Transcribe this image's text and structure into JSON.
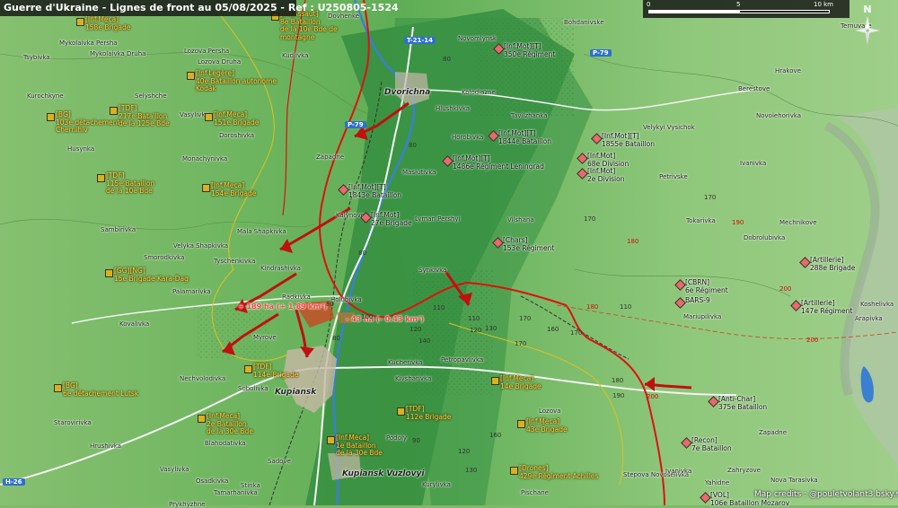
{
  "map": {
    "title": "Guerre d'Ukraine - Lignes de front au 05/08/2025 - Ref : U250805-1524",
    "credits": "Map credits : @pouletvolant3.bsky.social",
    "scale": {
      "labels": [
        "0",
        "5",
        "10 km"
      ]
    },
    "compass_label": "N",
    "colors": {
      "ukraine_label": "#ffd33a",
      "front_line": "#e01010",
      "russian_unit": "#e86a6a",
      "ukraine_unit": "#d9b21a",
      "water": "#3a7fd0"
    }
  },
  "roads": [
    {
      "id": "r1",
      "label": "T-21-14"
    },
    {
      "id": "r2",
      "label": "P-79"
    },
    {
      "id": "r3",
      "label": "P-79"
    },
    {
      "id": "r4",
      "label": "H-26"
    }
  ],
  "areas": [
    {
      "id": "a1",
      "label": "+ 189 ha (+ 1.89 km²)"
    },
    {
      "id": "a2",
      "label": "- 43 ha (- 0.43 km²)"
    }
  ],
  "towns": [
    {
      "id": "t1",
      "label": "Dovhenke",
      "major": false
    },
    {
      "id": "t2",
      "label": "Bohdanivske",
      "major": false
    },
    {
      "id": "t3",
      "label": "Ternuvate",
      "major": false
    },
    {
      "id": "t4",
      "label": "Mykolaivka Persha",
      "major": false
    },
    {
      "id": "t5",
      "label": "Mykolaivka Druha",
      "major": false
    },
    {
      "id": "t6",
      "label": "Tsybivka",
      "major": false
    },
    {
      "id": "t7",
      "label": "Lozova Persha",
      "major": false
    },
    {
      "id": "t8",
      "label": "Lozova Druha",
      "major": false
    },
    {
      "id": "t9",
      "label": "Kudiivka",
      "major": false
    },
    {
      "id": "t10",
      "label": "Novomlynsk",
      "major": false
    },
    {
      "id": "t11",
      "label": "Hrakove",
      "major": false
    },
    {
      "id": "t12",
      "label": "Berestove",
      "major": false
    },
    {
      "id": "t13",
      "label": "Kurochkyne",
      "major": false
    },
    {
      "id": "t14",
      "label": "Selyshche",
      "major": false
    },
    {
      "id": "t15",
      "label": "Dvorichna",
      "major": true
    },
    {
      "id": "t16",
      "label": "Kolodiazne",
      "major": false
    },
    {
      "id": "t17",
      "label": "Hlushkivka",
      "major": false
    },
    {
      "id": "t18",
      "label": "Tavilzhanka",
      "major": false
    },
    {
      "id": "t19",
      "label": "Velykyi Vysichok",
      "major": false
    },
    {
      "id": "t20",
      "label": "Novoiehorivka",
      "major": false
    },
    {
      "id": "t21",
      "label": "Vasylivka",
      "major": false
    },
    {
      "id": "t22",
      "label": "Doroshivka",
      "major": false
    },
    {
      "id": "t23",
      "label": "Horobivka",
      "major": false
    },
    {
      "id": "t24",
      "label": "Husynka",
      "major": false
    },
    {
      "id": "t25",
      "label": "Monachynivka",
      "major": false
    },
    {
      "id": "t26",
      "label": "Zapadne",
      "major": false
    },
    {
      "id": "t27",
      "label": "Masiutivka",
      "major": false
    },
    {
      "id": "t28",
      "label": "Petrivske",
      "major": false
    },
    {
      "id": "t29",
      "label": "Ivanivka",
      "major": false
    },
    {
      "id": "t30",
      "label": "Kalynove",
      "major": false
    },
    {
      "id": "t31",
      "label": "Lyman Pershyi",
      "major": false
    },
    {
      "id": "t32",
      "label": "Vilshana",
      "major": false
    },
    {
      "id": "t33",
      "label": "Tokarivka",
      "major": false
    },
    {
      "id": "t34",
      "label": "Mechnikove",
      "major": false
    },
    {
      "id": "t35",
      "label": "Sambirivka",
      "major": false
    },
    {
      "id": "t36",
      "label": "Mala Shapkivka",
      "major": false
    },
    {
      "id": "t37",
      "label": "Velyka Shapkivka",
      "major": false
    },
    {
      "id": "t38",
      "label": "Dobrolubivka",
      "major": false
    },
    {
      "id": "t39",
      "label": "Smorodkivka",
      "major": false
    },
    {
      "id": "t40",
      "label": "Tyschenkivka",
      "major": false
    },
    {
      "id": "t41",
      "label": "Kindrashivka",
      "major": false
    },
    {
      "id": "t42",
      "label": "Synkivka",
      "major": false
    },
    {
      "id": "t43",
      "label": "Palamarivka",
      "major": false
    },
    {
      "id": "t44",
      "label": "Radkivka",
      "major": false
    },
    {
      "id": "t45",
      "label": "Holubivka",
      "major": false
    },
    {
      "id": "t46",
      "label": "Kovalivka",
      "major": false
    },
    {
      "id": "t47",
      "label": "Myrove",
      "major": false
    },
    {
      "id": "t48",
      "label": "Mariupilivka",
      "major": false
    },
    {
      "id": "t49",
      "label": "Arapivka",
      "major": false
    },
    {
      "id": "t50",
      "label": "Koshelivka",
      "major": false
    },
    {
      "id": "t51",
      "label": "Petropavlivka",
      "major": false
    },
    {
      "id": "t52",
      "label": "Kucherivka",
      "major": false
    },
    {
      "id": "t53",
      "label": "Nechvolodivka",
      "major": false
    },
    {
      "id": "t54",
      "label": "Sobolivka",
      "major": false
    },
    {
      "id": "t55",
      "label": "Kupiansk",
      "major": true
    },
    {
      "id": "t56",
      "label": "Kivsharivka",
      "major": false
    },
    {
      "id": "t57",
      "label": "Lozova",
      "major": false
    },
    {
      "id": "t58",
      "label": "Starovirivka",
      "major": false
    },
    {
      "id": "t59",
      "label": "Hrushivka",
      "major": false
    },
    {
      "id": "t60",
      "label": "Blahodativka",
      "major": false
    },
    {
      "id": "t61",
      "label": "Vasylivka",
      "major": false
    },
    {
      "id": "t62",
      "label": "Sadove",
      "major": false
    },
    {
      "id": "t63",
      "label": "Podoly",
      "major": false
    },
    {
      "id": "t64",
      "label": "Kupiansk Vuzlovyi",
      "major": true
    },
    {
      "id": "t65",
      "label": "Kurylivka",
      "major": false
    },
    {
      "id": "t66",
      "label": "Stepova Novoselivka",
      "major": false
    },
    {
      "id": "t67",
      "label": "Ivanivka",
      "major": false
    },
    {
      "id": "t68",
      "label": "Zahryzove",
      "major": false
    },
    {
      "id": "t69",
      "label": "Zapadne",
      "major": false
    },
    {
      "id": "t70",
      "label": "Nova Tarasivka",
      "major": false
    },
    {
      "id": "t71",
      "label": "Yahidne",
      "major": false
    },
    {
      "id": "t72",
      "label": "Osadkivka",
      "major": false
    },
    {
      "id": "t73",
      "label": "Tamarhanivka",
      "major": false
    },
    {
      "id": "t74",
      "label": "Stinka",
      "major": false
    },
    {
      "id": "t75",
      "label": "Pischane",
      "major": false
    },
    {
      "id": "t76",
      "label": "Prykhyzhne",
      "major": false
    }
  ],
  "units_ukraine": [
    {
      "id": "u1",
      "lines": [
        "[Inf.Meca]",
        "158e Brigade"
      ]
    },
    {
      "id": "u2",
      "lines": [
        "[Inf.Assaut]",
        "8e Bataillon",
        "de la 10e Bde de",
        "montagne"
      ]
    },
    {
      "id": "u3",
      "lines": [
        "[Inf.Légère]",
        "40e Bataillon autonome",
        "Kodak"
      ]
    },
    {
      "id": "u4",
      "lines": [
        "[BG]",
        "103e détachement",
        "Chernihiv"
      ]
    },
    {
      "id": "u5",
      "lines": [
        "[TDF]",
        "217e Bataillon",
        "de la 125e Bde"
      ]
    },
    {
      "id": "u6",
      "lines": [
        "[Inf.Meca]",
        "151e Brigade"
      ]
    },
    {
      "id": "u7",
      "lines": [
        "[TDF]",
        "115e Bataillon",
        "de la 10e Bde"
      ]
    },
    {
      "id": "u8",
      "lines": [
        "[Inf.Meca]",
        "154e Brigade"
      ]
    },
    {
      "id": "u9",
      "lines": [
        "[GG][NG]",
        "15e Brigade Kara-Dag"
      ]
    },
    {
      "id": "u10",
      "lines": [
        "[BG]",
        "6e détachement Lutsk"
      ]
    },
    {
      "id": "u11",
      "lines": [
        "[TDF]",
        "114e Brigade"
      ]
    },
    {
      "id": "u12",
      "lines": [
        "[Inf.Meca]",
        "2e Bataillon",
        "de la 30e Bde"
      ]
    },
    {
      "id": "u13",
      "lines": [
        "[Inf.Meca]",
        "1e Bataillon",
        "de la 30e Bde"
      ]
    },
    {
      "id": "u14",
      "lines": [
        "[TDF]",
        "112e Brigade"
      ]
    },
    {
      "id": "u15",
      "lines": [
        "[Inf.Meca]",
        "14e Brigade"
      ]
    },
    {
      "id": "u16",
      "lines": [
        "[Inf.Meca]",
        "43e Brigade"
      ]
    },
    {
      "id": "u17",
      "lines": [
        "[Drones]",
        "429e Régiment Achilles"
      ]
    }
  ],
  "units_russia": [
    {
      "id": "r1",
      "lines": [
        "[Inf.Mot][T]",
        "350e Régiment"
      ]
    },
    {
      "id": "r2",
      "lines": [
        "[Inf.Mot][T]",
        "1844e Bataillon"
      ]
    },
    {
      "id": "r3",
      "lines": [
        "[Inf.Mot][T]",
        "1855e Bataillon"
      ]
    },
    {
      "id": "r4",
      "lines": [
        "[Inf.Mot][T]",
        "1486e Régiment Leningrad"
      ]
    },
    {
      "id": "r5",
      "lines": [
        "[Inf.Mot]",
        "68e Division"
      ]
    },
    {
      "id": "r6",
      "lines": [
        "[Inf.Mot]",
        "2e Division"
      ]
    },
    {
      "id": "r7",
      "lines": [
        "[Inf.Mot][T]",
        "1843e Bataillon"
      ]
    },
    {
      "id": "r8",
      "lines": [
        "[Inf.Mot]",
        "27e Brigade"
      ]
    },
    {
      "id": "r9",
      "lines": [
        "[Chars]",
        "153e Régiment"
      ]
    },
    {
      "id": "r10",
      "lines": [
        "[Artillerie]",
        "288e Brigade"
      ]
    },
    {
      "id": "r11",
      "lines": [
        "[CBRN]",
        "6e Régiment"
      ]
    },
    {
      "id": "r12",
      "lines": [
        "BARS-9"
      ]
    },
    {
      "id": "r13",
      "lines": [
        "[Artillerie]",
        "147e Régiment"
      ]
    },
    {
      "id": "r14",
      "lines": [
        "[Anti-Char]",
        "375e Bataillon"
      ]
    },
    {
      "id": "r15",
      "lines": [
        "[Recon]",
        "7e Bataillon"
      ]
    },
    {
      "id": "r16",
      "lines": [
        "[VOL]",
        "106e Bataillon Mozarov"
      ]
    }
  ],
  "elevations": [
    {
      "id": "e1",
      "label": "80",
      "red": false
    },
    {
      "id": "e2",
      "label": "80",
      "red": false
    },
    {
      "id": "e3",
      "label": "170",
      "red": false
    },
    {
      "id": "e4",
      "label": "170",
      "red": false
    },
    {
      "id": "e5",
      "label": "190",
      "red": true
    },
    {
      "id": "e6",
      "label": "180",
      "red": true
    },
    {
      "id": "e7",
      "label": "180",
      "red": true
    },
    {
      "id": "e8",
      "label": "110",
      "red": false
    },
    {
      "id": "e9",
      "label": "200",
      "red": true
    },
    {
      "id": "e10",
      "label": "200",
      "red": true
    },
    {
      "id": "e11",
      "label": "200",
      "red": true
    },
    {
      "id": "e12",
      "label": "110",
      "red": false
    },
    {
      "id": "e13",
      "label": "120",
      "red": false
    },
    {
      "id": "e14",
      "label": "130",
      "red": false
    },
    {
      "id": "e15",
      "label": "170",
      "red": false
    },
    {
      "id": "e16",
      "label": "160",
      "red": false
    },
    {
      "id": "e17",
      "label": "180",
      "red": false
    },
    {
      "id": "e18",
      "label": "190",
      "red": false
    },
    {
      "id": "e19",
      "label": "80",
      "red": false
    },
    {
      "id": "e20",
      "label": "100",
      "red": false
    },
    {
      "id": "e21",
      "label": "110",
      "red": false
    },
    {
      "id": "e22",
      "label": "120",
      "red": false
    },
    {
      "id": "e23",
      "label": "140",
      "red": false
    },
    {
      "id": "e24",
      "label": "160",
      "red": false
    },
    {
      "id": "e25",
      "label": "170",
      "red": false
    },
    {
      "id": "e26",
      "label": "90",
      "red": false
    },
    {
      "id": "e27",
      "label": "120",
      "red": false
    },
    {
      "id": "e28",
      "label": "130",
      "red": false
    },
    {
      "id": "e29",
      "label": "80",
      "red": false
    },
    {
      "id": "e30",
      "label": "170",
      "red": false
    },
    {
      "id": "e31",
      "label": "80",
      "red": false
    }
  ]
}
